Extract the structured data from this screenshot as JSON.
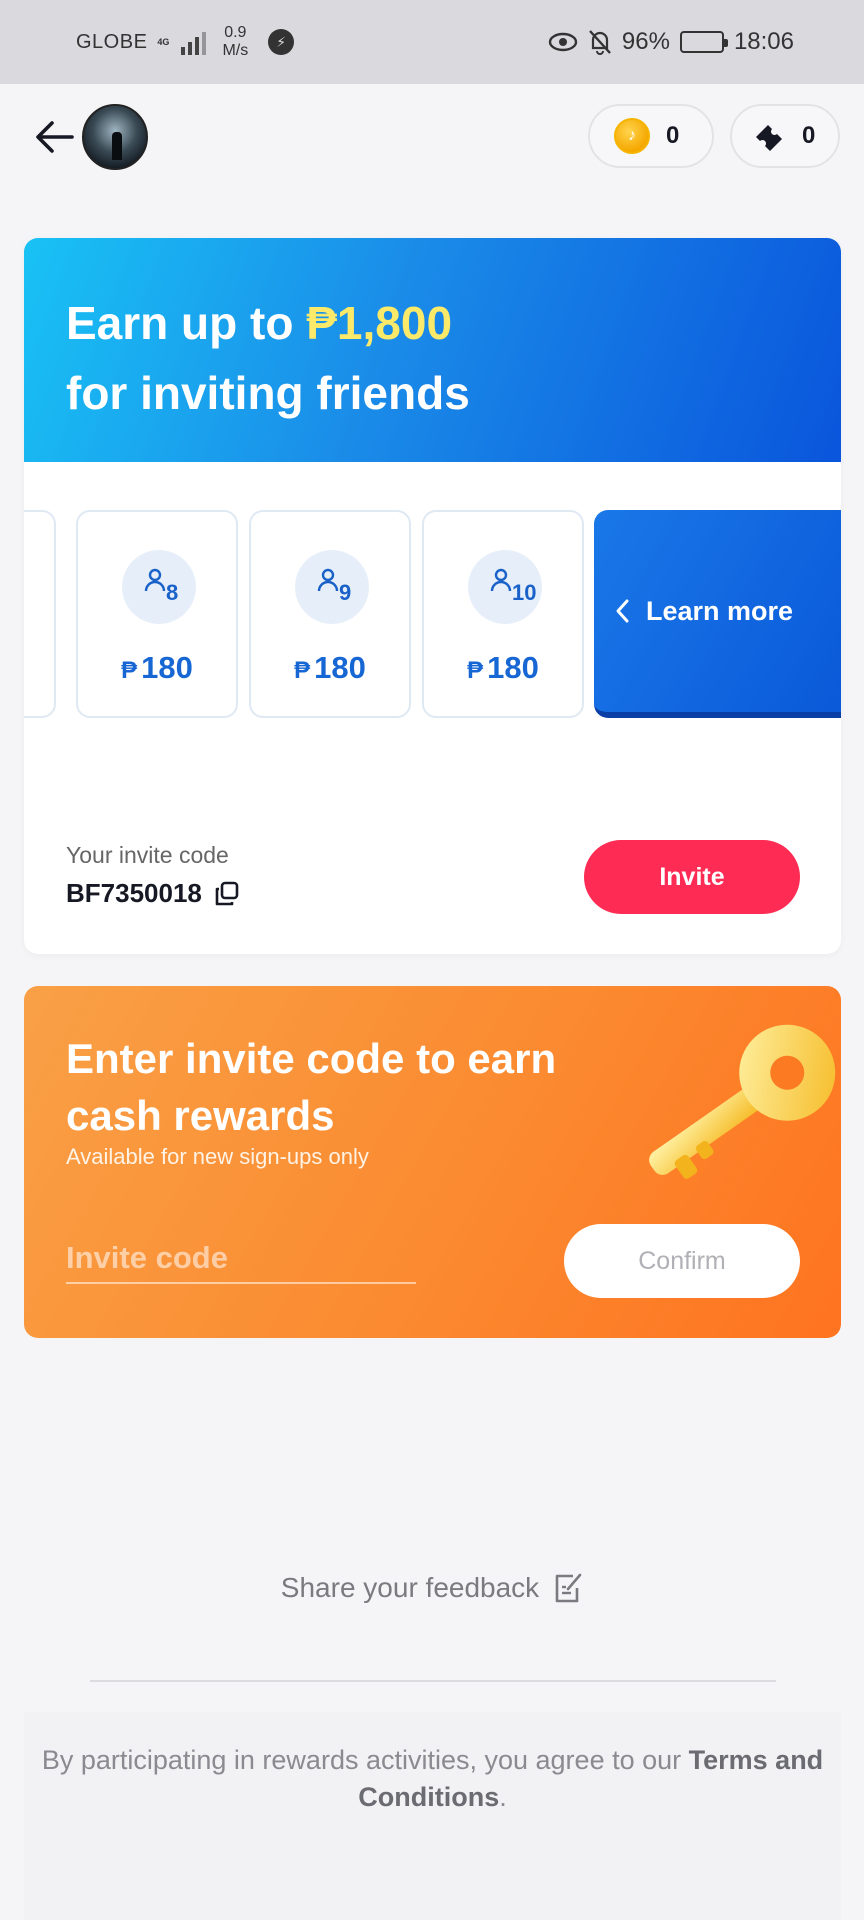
{
  "status_bar": {
    "carrier": "GLOBE",
    "network": "4G",
    "speed_value": "0.9",
    "speed_unit": "M/s",
    "battery": "96%",
    "battery_level": 0.96,
    "time": "18:06"
  },
  "header": {
    "coins": "0",
    "tickets": "0"
  },
  "invite_card": {
    "title_prefix": "Earn up to ",
    "title_amount": "₱1,800",
    "title_suffix": "for inviting friends",
    "tiers": [
      {
        "count": "8",
        "currency": "₱",
        "reward": "180"
      },
      {
        "count": "9",
        "currency": "₱",
        "reward": "180"
      },
      {
        "count": "10",
        "currency": "₱",
        "reward": "180"
      }
    ],
    "learn_more": "Learn more",
    "code_label": "Your invite code",
    "code_value": "BF7350018",
    "invite_button": "Invite"
  },
  "enter_code_card": {
    "title": "Enter invite code to earn cash rewards",
    "subtitle": "Available for new sign-ups only",
    "input_placeholder": "Invite code",
    "input_value": "",
    "confirm_button": "Confirm"
  },
  "footer": {
    "feedback": "Share your feedback",
    "terms_prefix": "By participating in rewards activities, you agree to our ",
    "terms_link": "Terms and Conditions",
    "terms_suffix": "."
  },
  "colors": {
    "accent_red": "#fe2c55",
    "banner_blue": "#1a8be8",
    "reward_blue": "#1666d3",
    "orange": "#fb8a30",
    "highlight_yellow": "#fbe96a"
  }
}
